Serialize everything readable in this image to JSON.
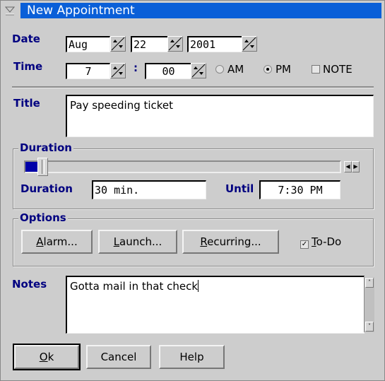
{
  "window": {
    "title": "New Appointment"
  },
  "date": {
    "label": "Date",
    "month": "Aug",
    "day": "22",
    "year": "2001"
  },
  "time": {
    "label": "Time",
    "hour": "7",
    "separator": ":",
    "minute": "00",
    "am_label": "AM",
    "pm_label": "PM",
    "selected": "PM",
    "note_label": "NOTE",
    "note_checked": false
  },
  "title": {
    "label": "Title",
    "value": "Pay speeding ticket"
  },
  "duration": {
    "group_label": "Duration",
    "slider_fraction": 0.05,
    "duration_label": "Duration",
    "duration_value": "30 min.",
    "until_label": "Until",
    "until_value": "7:30 PM"
  },
  "options": {
    "group_label": "Options",
    "buttons": [
      {
        "mnemonic": "A",
        "rest": "larm..."
      },
      {
        "mnemonic": "L",
        "rest": "aunch..."
      },
      {
        "mnemonic": "R",
        "rest": "ecurring..."
      }
    ],
    "todo": {
      "mnemonic": "T",
      "rest": "o-Do",
      "checked": true,
      "check_glyph": "✓"
    }
  },
  "notes": {
    "label": "Notes",
    "value": "Gotta mail in that check"
  },
  "footer": {
    "ok": {
      "mnemonic": "O",
      "rest": "k"
    },
    "cancel": "Cancel",
    "help": "Help"
  },
  "icons": {
    "spin": "spin-arrows-icon",
    "left": "◀",
    "right": "▶",
    "up": "˄",
    "down": "˅"
  }
}
